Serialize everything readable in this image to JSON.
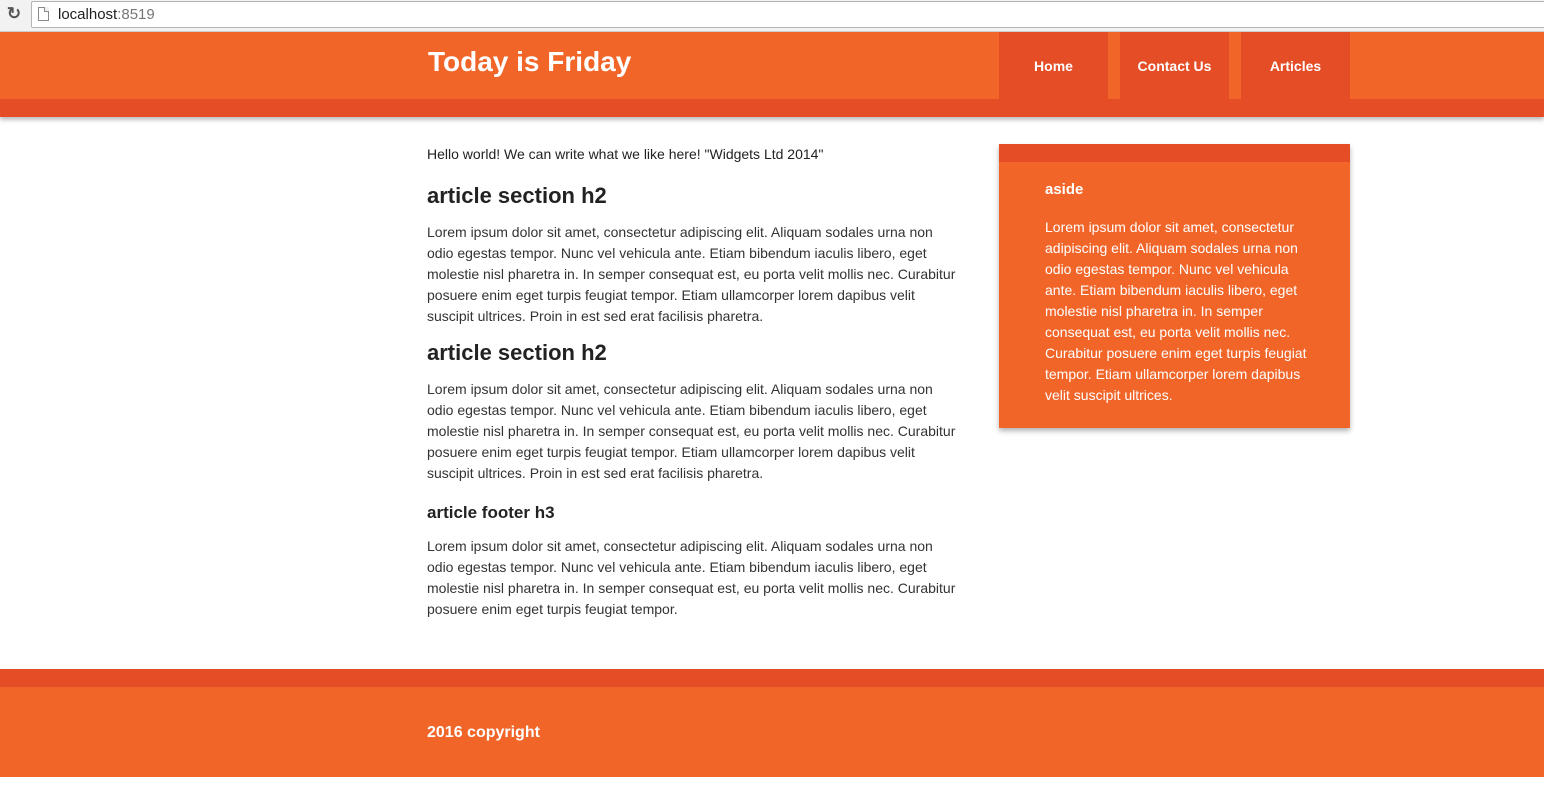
{
  "browser": {
    "url_host": "localhost",
    "url_port": ":8519"
  },
  "colors": {
    "primary": "#F16529",
    "dark": "#E44D26",
    "text": "#222222"
  },
  "header": {
    "title": "Today is Friday",
    "nav": [
      {
        "label": "Home"
      },
      {
        "label": "Contact Us"
      },
      {
        "label": "Articles"
      }
    ]
  },
  "main": {
    "intro": "Hello world! We can write what we like here! \"Widgets Ltd 2014\"",
    "sections": [
      {
        "heading": "article section h2",
        "text": "Lorem ipsum dolor sit amet, consectetur adipiscing elit. Aliquam sodales urna non odio egestas tempor. Nunc vel vehicula ante. Etiam bibendum iaculis libero, eget molestie nisl pharetra in. In semper consequat est, eu porta velit mollis nec. Curabitur posuere enim eget turpis feugiat tempor. Etiam ullamcorper lorem dapibus velit suscipit ultrices. Proin in est sed erat facilisis pharetra."
      },
      {
        "heading": "article section h2",
        "text": "Lorem ipsum dolor sit amet, consectetur adipiscing elit. Aliquam sodales urna non odio egestas tempor. Nunc vel vehicula ante. Etiam bibendum iaculis libero, eget molestie nisl pharetra in. In semper consequat est, eu porta velit mollis nec. Curabitur posuere enim eget turpis feugiat tempor. Etiam ullamcorper lorem dapibus velit suscipit ultrices. Proin in est sed erat facilisis pharetra."
      }
    ],
    "footer": {
      "heading": "article footer h3",
      "text": "Lorem ipsum dolor sit amet, consectetur adipiscing elit. Aliquam sodales urna non odio egestas tempor. Nunc vel vehicula ante. Etiam bibendum iaculis libero, eget molestie nisl pharetra in. In semper consequat est, eu porta velit mollis nec. Curabitur posuere enim eget turpis feugiat tempor."
    }
  },
  "aside": {
    "title": "aside",
    "text": "Lorem ipsum dolor sit amet, consectetur adipiscing elit. Aliquam sodales urna non odio egestas tempor. Nunc vel vehicula ante. Etiam bibendum iaculis libero, eget molestie nisl pharetra in. In semper consequat est, eu porta velit mollis nec. Curabitur posuere enim eget turpis feugiat tempor. Etiam ullamcorper lorem dapibus velit suscipit ultrices."
  },
  "footer": {
    "copyright": "2016 copyright"
  }
}
